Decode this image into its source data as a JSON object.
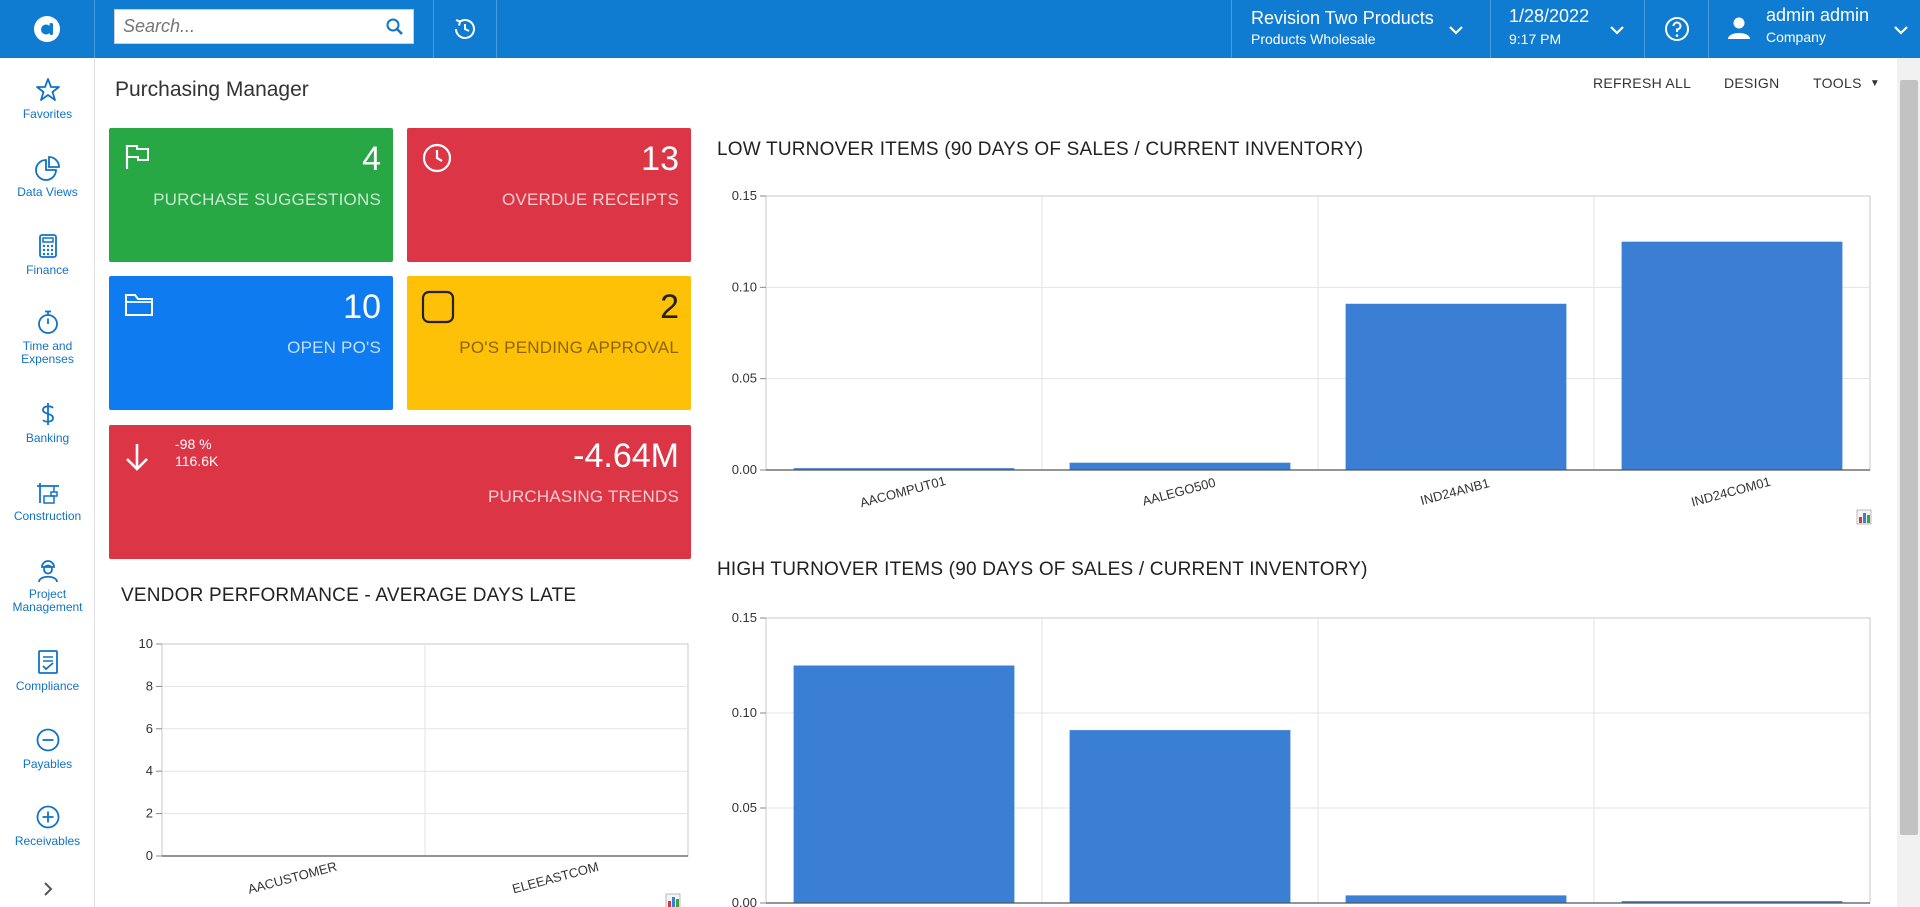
{
  "topbar": {
    "search_placeholder": "Search...",
    "tenant": {
      "name": "Revision Two Products",
      "branch": "Products Wholesale"
    },
    "datetime": {
      "date": "1/28/2022",
      "time": "9:17 PM"
    },
    "user": {
      "name": "admin admin",
      "company": "Company"
    }
  },
  "sidebar": {
    "items": [
      {
        "label": "Favorites",
        "icon": "star-icon"
      },
      {
        "label": "Data Views",
        "icon": "pie-chart-icon"
      },
      {
        "label": "Finance",
        "icon": "calculator-icon"
      },
      {
        "label": "Time and Expenses",
        "icon": "stopwatch-icon"
      },
      {
        "label": "Banking",
        "icon": "dollar-icon"
      },
      {
        "label": "Construction",
        "icon": "crane-icon"
      },
      {
        "label": "Project Management",
        "icon": "worker-icon"
      },
      {
        "label": "Compliance",
        "icon": "checklist-icon"
      },
      {
        "label": "Payables",
        "icon": "minus-circle-icon"
      },
      {
        "label": "Receivables",
        "icon": "plus-circle-icon"
      }
    ]
  },
  "page": {
    "title": "Purchasing Manager",
    "toolbar": {
      "refresh": "REFRESH ALL",
      "design": "DESIGN",
      "tools": "TOOLS"
    }
  },
  "tiles": {
    "purchase_suggestions": {
      "value": "4",
      "label": "PURCHASE SUGGESTIONS",
      "color": "#28a745"
    },
    "overdue_receipts": {
      "value": "13",
      "label": "OVERDUE RECEIPTS",
      "color": "#dc3545"
    },
    "open_pos": {
      "value": "10",
      "label": "OPEN PO'S",
      "color": "#0f7bf0"
    },
    "pending_approval": {
      "value": "2",
      "label": "PO'S PENDING APPROVAL",
      "color": "#ffc107"
    },
    "purchasing_trends": {
      "value": "-4.64M",
      "label": "PURCHASING TRENDS",
      "change_pct": "-98 %",
      "prev": "116.6K",
      "color": "#dc3545"
    }
  },
  "chart_data": [
    {
      "id": "low_turnover",
      "type": "bar",
      "title": "LOW TURNOVER ITEMS (90 DAYS OF SALES / CURRENT INVENTORY)",
      "categories": [
        "AACOMPUT01",
        "AALEGO500",
        "IND24ANB1",
        "IND24COM01"
      ],
      "values": [
        0.001,
        0.004,
        0.091,
        0.125
      ],
      "ylim": [
        0,
        0.15
      ],
      "yticks": [
        "0.00",
        "0.05",
        "0.10",
        "0.15"
      ],
      "color": "#3a7fd4",
      "grid": true
    },
    {
      "id": "vendor_performance",
      "type": "bar",
      "title": "VENDOR PERFORMANCE - AVERAGE DAYS LATE",
      "categories": [
        "AACUSTOMER",
        "ELEEASTCOM"
      ],
      "values": [
        0,
        0
      ],
      "ylim": [
        0,
        10
      ],
      "yticks": [
        "0",
        "2",
        "4",
        "6",
        "8",
        "10"
      ],
      "color": "#3a7fd4",
      "grid": true
    },
    {
      "id": "high_turnover",
      "type": "bar",
      "title": "HIGH TURNOVER ITEMS (90 DAYS OF SALES / CURRENT INVENTORY)",
      "values": [
        0.125,
        0.091,
        0.004,
        0.001
      ],
      "ylim": [
        0,
        0.15
      ],
      "yticks": [
        "0.00",
        "0.05",
        "0.10",
        "0.15"
      ],
      "color": "#3a7fd4",
      "grid": true
    }
  ]
}
